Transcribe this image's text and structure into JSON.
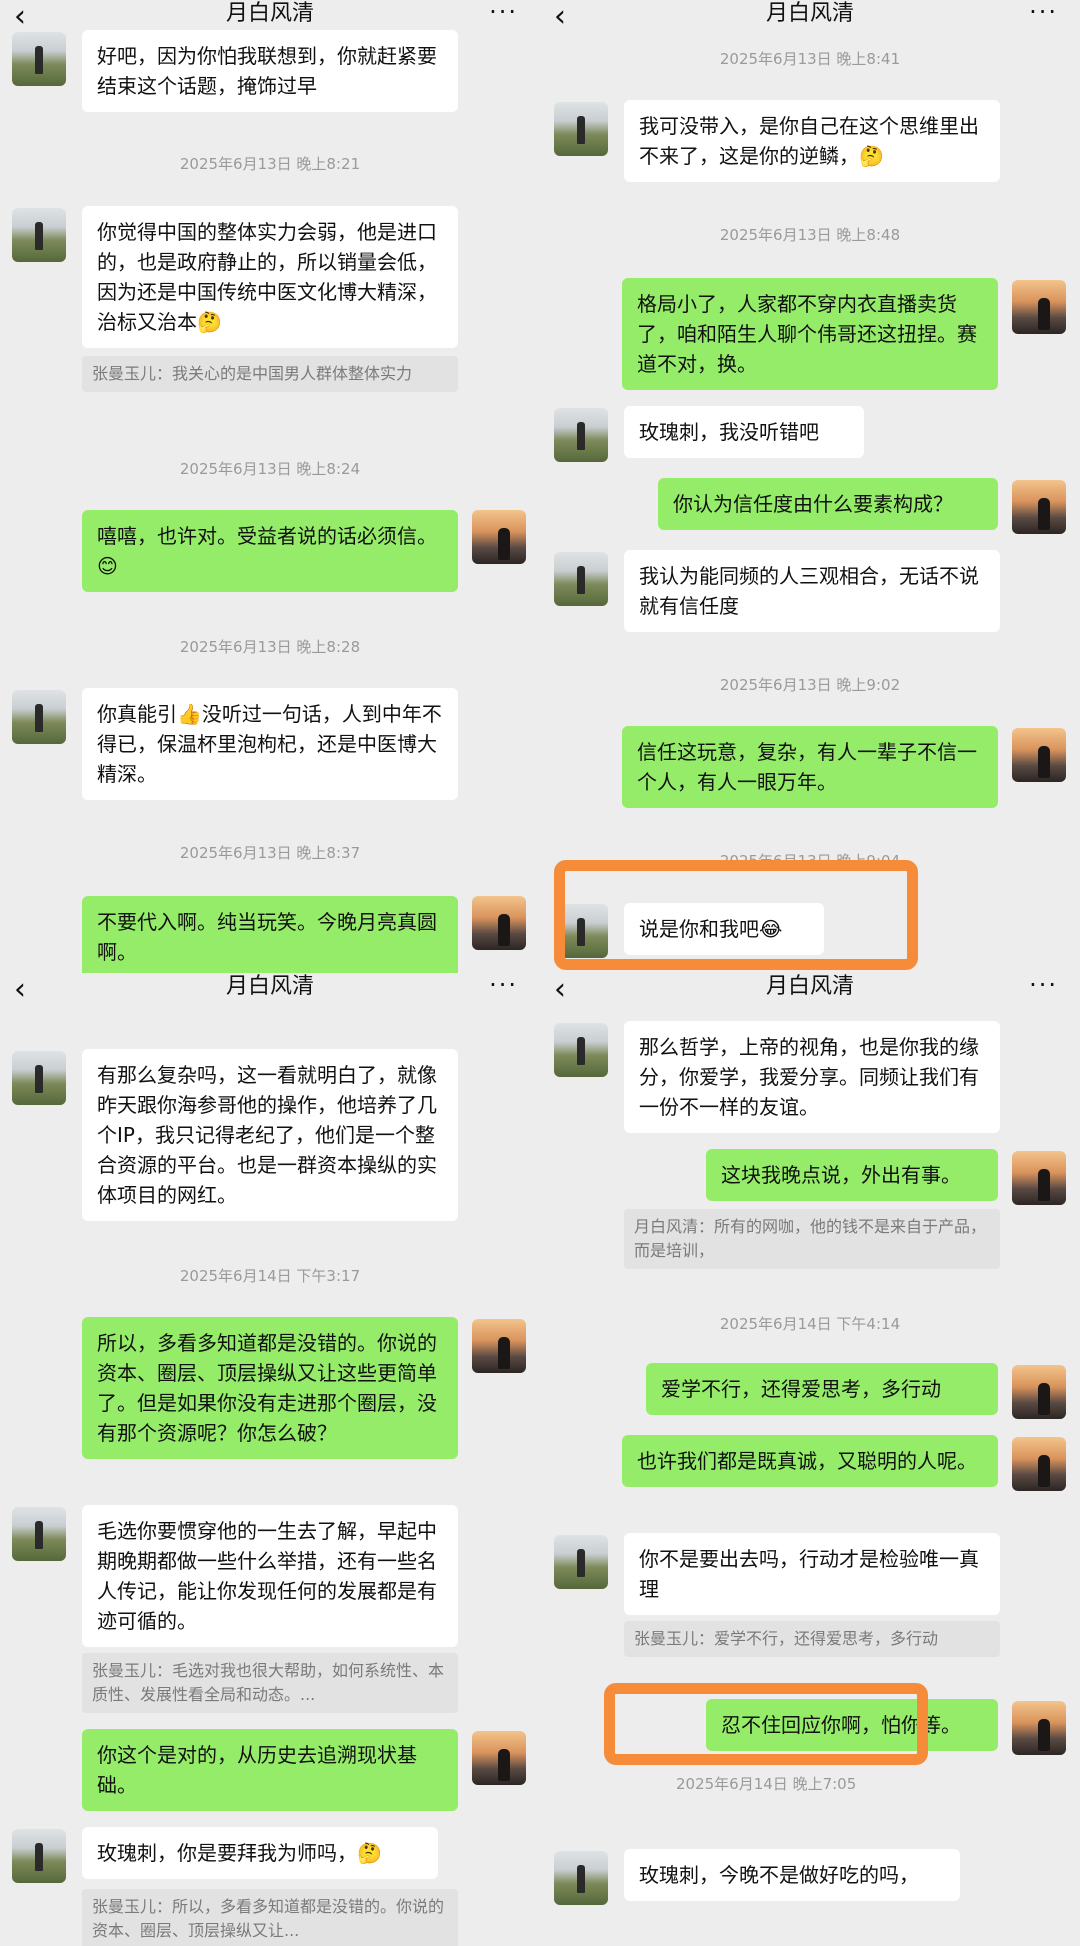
{
  "header": {
    "title": "月白风清",
    "back_icon": "‹",
    "more_icon": "···"
  },
  "p1": {
    "b0": "好吧，因为你怕我联想到，你就赶紧要结束这个话题，掩饰过早",
    "t1": "2025年6月13日 晚上8:21",
    "b1": "你觉得中国的整体实力会弱，他是进口的，也是政府静止的，所以销量会低，因为还是中国传统中医文化博大精深，治标又治本🤔",
    "q1": "张曼玉儿：我关心的是中国男人群体整体实力",
    "t2": "2025年6月13日 晚上8:24",
    "b2": "嘻嘻，也许对。受益者说的话必须信。😊",
    "t3": "2025年6月13日 晚上8:28",
    "b3": "你真能引👍没听过一句话，人到中年不得已，保温杯里泡枸杞，还是中医博大精深。",
    "t4": "2025年6月13日 晚上8:37",
    "b4": "不要代入啊。纯当玩笑。今晚月亮真圆啊。"
  },
  "p2": {
    "t0": "2025年6月13日 晚上8:41",
    "b1": "我可没带入，是你自己在这个思维里出不来了，这是你的逆鳞，🤔",
    "t1": "2025年6月13日 晚上8:48",
    "b2": "格局小了，人家都不穿内衣直播卖货了，咱和陌生人聊个伟哥还这扭捏。赛道不对，换。",
    "b3": "玫瑰刺，我没听错吧",
    "b4": "你认为信任度由什么要素构成？",
    "b5": "我认为能同频的人三观相合，无话不说就有信任度",
    "t2": "2025年6月13日 晚上9:02",
    "b6": "信任这玩意，复杂，有人一辈子不信一个人，有人一眼万年。",
    "t3": "2025年6月13日 晚上9:04",
    "b7": "说是你和我吧😂"
  },
  "p3": {
    "b1": "有那么复杂吗，这一看就明白了，就像昨天跟你海参哥他的操作，他培养了几个IP，我只记得老纪了，他们是一个整合资源的平台。也是一群资本操纵的实体项目的网红。",
    "t1": "2025年6月14日 下午3:17",
    "b2": "所以，多看多知道都是没错的。你说的资本、圈层、顶层操纵又让这些更简单了。但是如果你没有走进那个圈层，没有那个资源呢？你怎么破？",
    "b3": "毛选你要惯穿他的一生去了解，早起中期晚期都做一些什么举措，还有一些名人传记，能让你发现任何的发展都是有迹可循的。",
    "q3": "张曼玉儿：毛选对我也很大帮助，如何系统性、本质性、发展性看全局和动态。...",
    "b4": "你这个是对的，从历史去追溯现状基础。",
    "b5": "玫瑰刺，你是要拜我为师吗，🤔",
    "q5": "张曼玉儿：所以，多看多知道都是没错的。你说的资本、圈层、顶层操纵又让..."
  },
  "p4": {
    "b1": "那么哲学，上帝的视角，也是你我的缘分，你爱学，我爱分享。同频让我们有一份不一样的友谊。",
    "b2": "这块我晚点说，外出有事。",
    "q2": "月白风清：所有的网咖，他的钱不是来自于产品，而是培训，",
    "t1": "2025年6月14日 下午4:14",
    "b3": "爱学不行，还得爱思考，多行动",
    "b4": "也许我们都是既真诚，又聪明的人呢。",
    "b5": "你不是要出去吗，行动才是检验唯一真理",
    "q5": "张曼玉儿：爱学不行，还得爱思考，多行动",
    "b6": "忍不住回应你啊，怕你等。",
    "t2": "2025年6月14日 晚上7:05",
    "b7": "玫瑰刺，今晚不是做好吃的吗，"
  },
  "colors": {
    "incoming": "#ffffff",
    "outgoing": "#95ec69",
    "highlight": "#f68c3a",
    "background": "#ededed"
  }
}
